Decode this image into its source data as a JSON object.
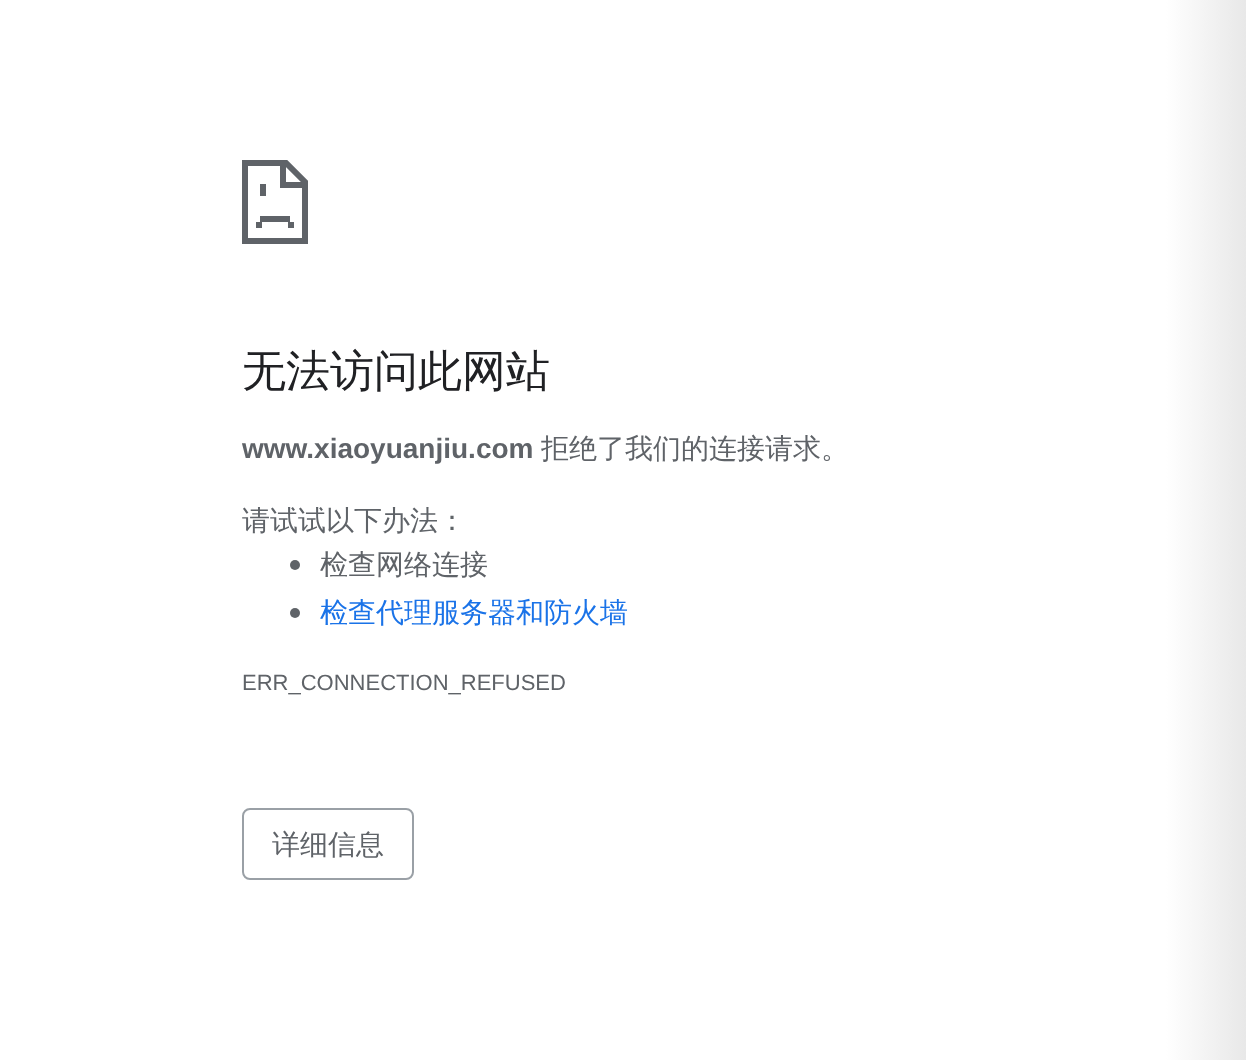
{
  "error_page": {
    "title": "无法访问此网站",
    "host": "www.xiaoyuanjiu.com",
    "message": "拒绝了我们的连接请求。",
    "suggestions_heading": "请试试以下办法：",
    "suggestions": [
      {
        "kind": "text",
        "label": "检查网络连接"
      },
      {
        "kind": "link",
        "label": "检查代理服务器和防火墙"
      }
    ],
    "error_code": "ERR_CONNECTION_REFUSED",
    "details_button": "详细信息"
  }
}
